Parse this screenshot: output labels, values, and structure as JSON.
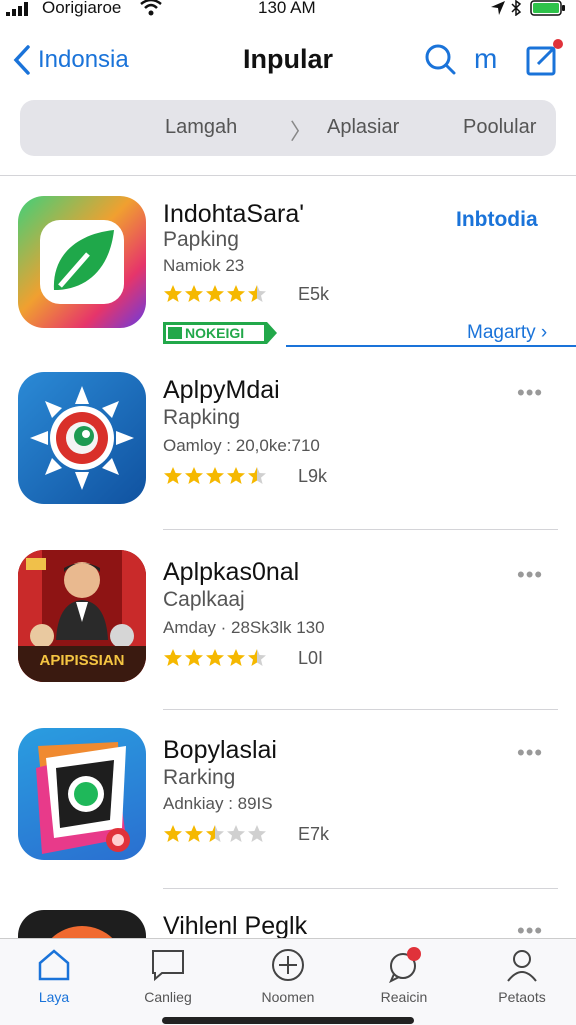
{
  "status_bar": {
    "carrier": "Oorigiaroe",
    "time": "130 AM"
  },
  "nav": {
    "back_label": "Indonsia",
    "title": "Inpular",
    "library_icon_text": "m"
  },
  "segments": {
    "first": "Lamgah",
    "second": "Aplasiar",
    "third": "Poolular"
  },
  "apps": [
    {
      "name": "IndohtaSara'",
      "category": "Papking",
      "meta": "Namiok 23",
      "rating_count": "E5k",
      "rating": 4.5,
      "action_label": "Inbtodia",
      "badge_label": "NOKEIGI",
      "bottom_link": "Magarty"
    },
    {
      "name": "AplpyMdai",
      "category": "Rapking",
      "meta": "Oamloy : 20,0ke:710",
      "rating_count": "L9k",
      "rating": 4.5
    },
    {
      "name": "Aplpkas0nal",
      "category": "Caplkaaj",
      "meta": "Amday · 28Sk3lk 130",
      "rating_count": "L0I",
      "rating": 4.5,
      "icon_banner_text": "APIPISSIAN"
    },
    {
      "name": "Bopylaslai",
      "category": "Rarking",
      "meta": "Adnkiay : 89IS",
      "rating_count": "E7k",
      "rating": 2.5
    },
    {
      "name": "Vihlenl Peglk"
    }
  ],
  "more_label": "•••",
  "tabs": [
    {
      "label": "Laya",
      "icon": "home-icon",
      "active": true
    },
    {
      "label": "Canlieg",
      "icon": "message-icon"
    },
    {
      "label": "Noomen",
      "icon": "plus-circle-icon"
    },
    {
      "label": "Reaicin",
      "icon": "chat-notification-icon"
    },
    {
      "label": "Petaots",
      "icon": "person-icon"
    }
  ],
  "colors": {
    "accent": "#1a73d9",
    "star": "#f5b800",
    "badge_green": "#22a84a"
  }
}
